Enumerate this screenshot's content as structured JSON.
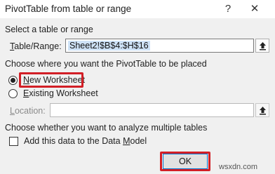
{
  "window": {
    "title": "PivotTable from table or range",
    "help_glyph": "?",
    "close_glyph": "✕"
  },
  "source_section": {
    "heading": "Select a table or range",
    "field_label_underline": "T",
    "field_label_rest": "able/Range:",
    "field_value": "Sheet2!$B$4:$H$16"
  },
  "placement_section": {
    "heading": "Choose where you want the PivotTable to be placed",
    "options": [
      {
        "underline": "N",
        "rest": "ew Worksheet",
        "selected": true
      },
      {
        "underline": "E",
        "rest": "xisting Worksheet",
        "selected": false
      }
    ],
    "location_label_underline": "L",
    "location_label_rest": "ocation:",
    "location_value": ""
  },
  "model_section": {
    "heading": "Choose whether you want to analyze multiple tables",
    "checkbox_label_prefix": "Add this data to the Data ",
    "checkbox_label_underline": "M",
    "checkbox_label_rest": "odel",
    "checked": false
  },
  "buttons": {
    "ok_label": "OK"
  },
  "watermark": "wsxdn.com",
  "colors": {
    "highlight": "#d21f26",
    "selection": "#cfe3f7",
    "ok_border": "#0078d7"
  }
}
